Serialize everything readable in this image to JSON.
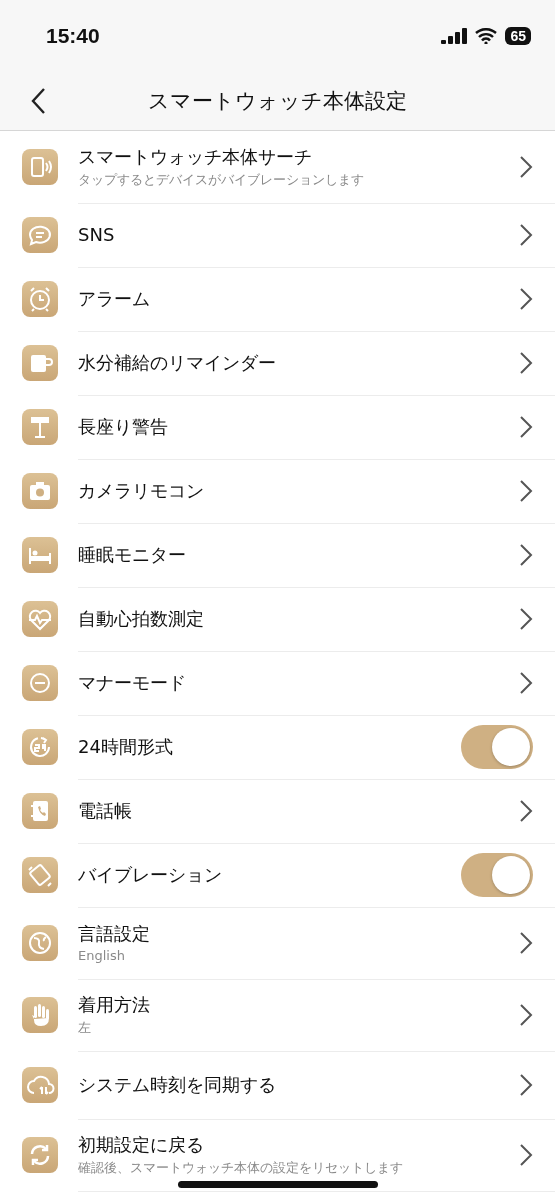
{
  "status_bar": {
    "time": "15:40",
    "battery": "65"
  },
  "nav": {
    "title": "スマートウォッチ本体設定"
  },
  "items": [
    {
      "kind": "link",
      "label": "スマートウォッチ本体サーチ",
      "subtitle": "タップするとデバイスがバイブレーションします"
    },
    {
      "kind": "link",
      "label": "SNS"
    },
    {
      "kind": "link",
      "label": "アラーム"
    },
    {
      "kind": "link",
      "label": "水分補給のリマインダー"
    },
    {
      "kind": "link",
      "label": "長座り警告"
    },
    {
      "kind": "link",
      "label": "カメラリモコン"
    },
    {
      "kind": "link",
      "label": "睡眠モニター"
    },
    {
      "kind": "link",
      "label": "自動心拍数測定"
    },
    {
      "kind": "link",
      "label": "マナーモード"
    },
    {
      "kind": "toggle",
      "label": "24時間形式",
      "on": true
    },
    {
      "kind": "link",
      "label": "電話帳"
    },
    {
      "kind": "toggle",
      "label": "バイブレーション",
      "on": true
    },
    {
      "kind": "link",
      "label": "言語設定",
      "subtitle": "English"
    },
    {
      "kind": "link",
      "label": "着用方法",
      "subtitle": "左"
    },
    {
      "kind": "link",
      "label": "システム時刻を同期する"
    },
    {
      "kind": "link",
      "label": "初期設定に戻る",
      "subtitle": "確認後、スマートウォッチ本体の設定をリセットします"
    }
  ]
}
